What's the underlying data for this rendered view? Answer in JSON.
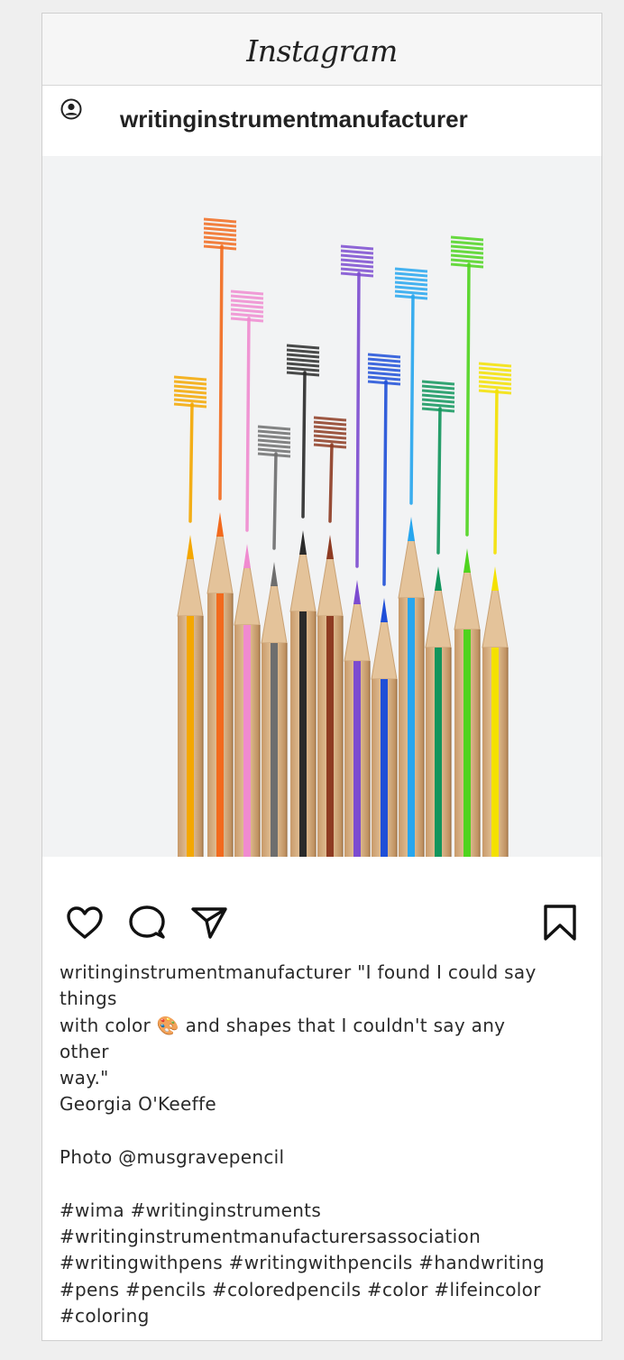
{
  "app": {
    "brand": "Instagram"
  },
  "post": {
    "username": "writinginstrumentmanufacturer",
    "image_description_icon": "colored-pencils-photo",
    "caption": {
      "line1": "writinginstrumentmanufacturer \"I found I could say",
      "line2": "things",
      "line3a": "with color",
      "emoji": "🎨",
      "line3b": "and shapes that I couldn't say any",
      "line4": "other",
      "line5": "way.\"",
      "line6": "Georgia O'Keeffe",
      "line7": "Photo @musgravepencil",
      "line8": "#wima #writinginstruments",
      "line9": "#writinginstrumentmanufacturersassociation",
      "line10": "#writingwithpens #writingwithpencils #handwriting",
      "line11": "#pens #pencils #coloredpencils #color #lifeincolor",
      "line12": "#coloring"
    }
  },
  "actions": {
    "icons": [
      "heart-icon",
      "comment-icon",
      "share-icon",
      "bookmark-icon"
    ]
  },
  "colors": {
    "pencils": [
      "#f4a700",
      "#f26a1d",
      "#f08bd0",
      "#6e6e6e",
      "#2a2a2a",
      "#8e3b22",
      "#7c4bd0",
      "#1f4fd8",
      "#27a6ee",
      "#11955c",
      "#4fd41e",
      "#f4e100"
    ]
  }
}
